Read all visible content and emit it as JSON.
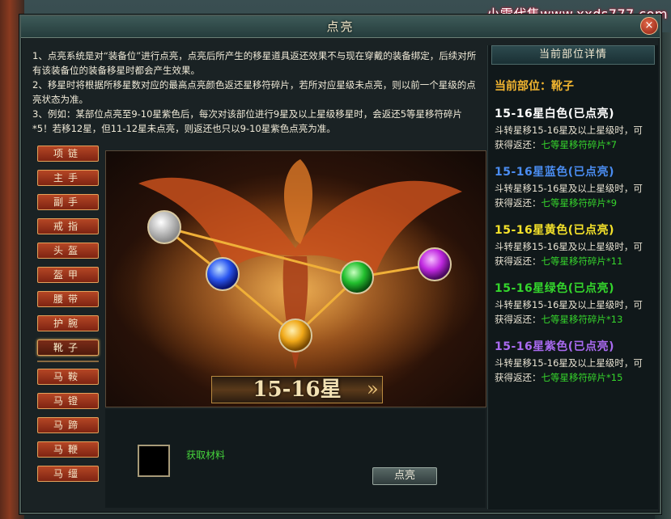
{
  "watermark": "小雪代售www.xxds777.com",
  "window": {
    "title": "点亮",
    "close_label": "×"
  },
  "description": [
    "1、点亮系统是对“装备位”进行点亮，点亮后所产生的移星道具返还效果不与现在穿戴的装备绑定，后续对所有该装备位的装备移星时都会产生效果。",
    "2、移星时将根据所移星数对应的最高点亮颜色返还星移符碎片，若所对应星级未点亮，则以前一个星级的点亮状态为准。",
    "3、例如：某部位点亮至9-10星紫色后，每次对该部位进行9星及以上星级移星时，会返还5等星移符碎片*5！若移12星，但11-12星未点亮，则返还也只以9-10星紫色点亮为准。"
  ],
  "slots": [
    "项链",
    "主手",
    "副手",
    "戒指",
    "头盔",
    "盔甲",
    "腰带",
    "护腕",
    "靴子",
    "马鞍",
    "马镫",
    "马蹄",
    "马鞭",
    "马缰"
  ],
  "active_slot": "靴子",
  "stage": {
    "star_range": "15-16星",
    "prev_arrow": "«",
    "next_arrow": "»"
  },
  "bottom": {
    "material_link": "获取材料",
    "light_button": "点亮"
  },
  "detail_panel": {
    "header": "当前部位详情",
    "current_slot": "当前部位：靴子",
    "tiers": [
      {
        "title": "15-16星白色(已点亮)",
        "color": "#ffffff",
        "desc": "斗转星移15-16星及以上星级时，可获得返还：",
        "reward": "七等星移符碎片*7"
      },
      {
        "title": "15-16星蓝色(已点亮)",
        "color": "#4a8cf0",
        "desc": "斗转星移15-16星及以上星级时，可获得返还：",
        "reward": "七等星移符碎片*9"
      },
      {
        "title": "15-16星黄色(已点亮)",
        "color": "#f5e22a",
        "desc": "斗转星移15-16星及以上星级时，可获得返还：",
        "reward": "七等星移符碎片*11"
      },
      {
        "title": "15-16星绿色(已点亮)",
        "color": "#34d62c",
        "desc": "斗转星移15-16星及以上星级时，可获得返还：",
        "reward": "七等星移符碎片*13"
      },
      {
        "title": "15-16星紫色(已点亮)",
        "color": "#a96af0",
        "desc": "斗转星移15-16星及以上星级时，可获得返还：",
        "reward": "七等星移符碎片*15"
      }
    ]
  },
  "orbs": [
    {
      "name": "white-orb",
      "color": "#f4f4f4"
    },
    {
      "name": "blue-orb",
      "color": "#2c5af0"
    },
    {
      "name": "yellow-orb",
      "color": "#f0b020"
    },
    {
      "name": "green-orb",
      "color": "#20c030"
    },
    {
      "name": "purple-orb",
      "color": "#c030e0"
    }
  ]
}
